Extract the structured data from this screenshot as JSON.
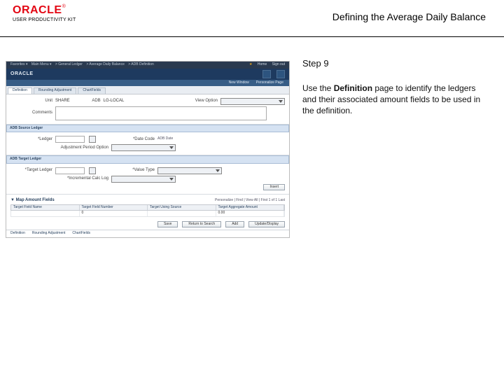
{
  "header": {
    "logo": "ORACLE",
    "reg": "®",
    "sub": "USER PRODUCTIVITY KIT",
    "title": "Defining the Average Daily Balance"
  },
  "pane": {
    "step": "Step 9",
    "desc_pre": "Use the ",
    "desc_bold": "Definition",
    "desc_post": " page to identify the ledgers and their associated amount fields to be used in the definition."
  },
  "app": {
    "crumbs": [
      "Favorites ▾",
      "Main Menu ▾",
      "> General Ledger",
      "> Average Daily Balance",
      "> ADB Definition"
    ],
    "topright": [
      "Home",
      "Sign out"
    ],
    "brand": "ORACLE",
    "bar3": [
      "New Window",
      "Personalize Page"
    ],
    "tabs": [
      "Definition",
      "Rounding Adjustment",
      "ChartFields"
    ],
    "row1": {
      "unit_lbl": "Unit",
      "unit_val": "SHARE",
      "adb_lbl": "ADB",
      "adb_val": "LG-LOCAL",
      "view_lbl": "View Option"
    },
    "comments_lbl": "Comments",
    "band1": "ADB Source Ledger",
    "src": {
      "ledger_lbl": "*Ledger",
      "date_lbl": "*Date Code",
      "date_val": "ADB Date",
      "adj_lbl": "Adjustment Period Option"
    },
    "band2": "ADB Target Ledger",
    "tgt": {
      "ledger_lbl": "*Target Ledger",
      "value_lbl": "*Value Type",
      "incr_lbl": "*Incremental Calc Log"
    },
    "btn_insert": "Insert",
    "grid_title": "▼ Map Amount Fields",
    "grid_tools": [
      "Personalize",
      "Find",
      "View All",
      "First",
      "1 of 1",
      "Last"
    ],
    "grid_cols": [
      "Target Field Name",
      "Target Field Number",
      "Target Using Source",
      "Target Aggregate Amount"
    ],
    "grid_row": [
      "",
      "0",
      "",
      "0.00"
    ],
    "footer": [
      "Save",
      "Return to Search",
      "Add",
      "Update/Display"
    ],
    "bottom_tabs": [
      "Definition",
      "Rounding Adjustment",
      "ChartFields"
    ]
  }
}
